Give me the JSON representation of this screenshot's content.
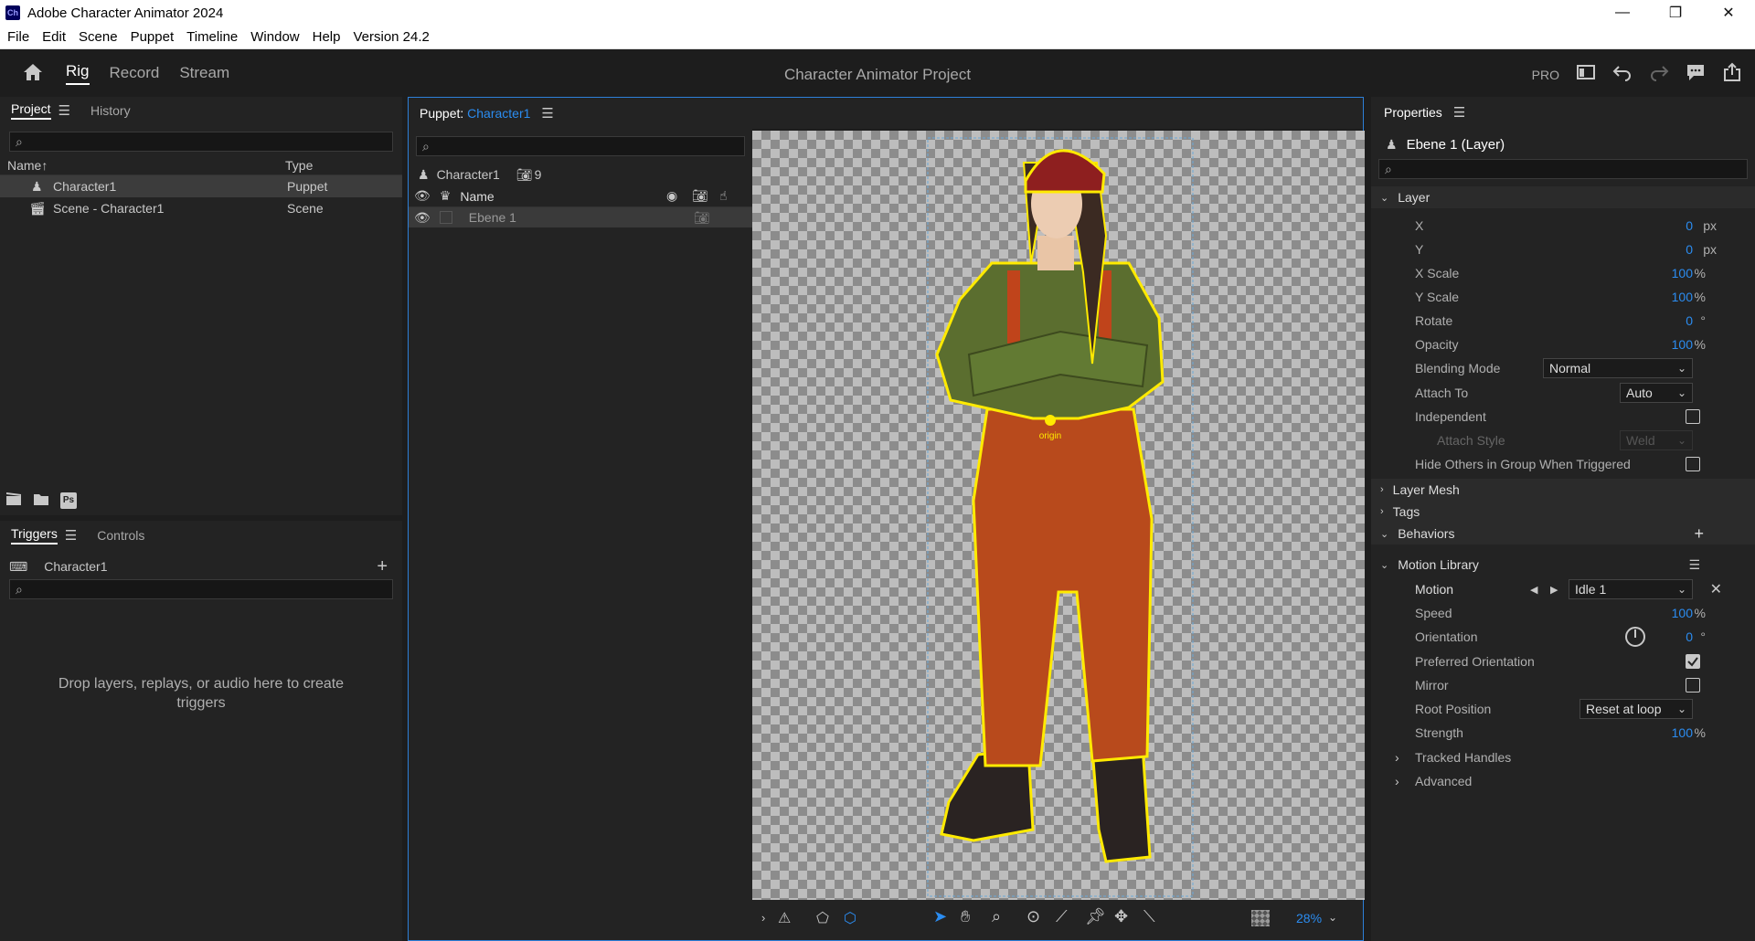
{
  "window": {
    "app_icon": "Ch",
    "title": "Adobe Character Animator 2024",
    "controls": [
      "—",
      "❐",
      "✕"
    ]
  },
  "menu": [
    "File",
    "Edit",
    "Scene",
    "Puppet",
    "Timeline",
    "Window",
    "Help",
    "Version 24.2"
  ],
  "workspace": {
    "tabs": [
      "Rig",
      "Record",
      "Stream"
    ],
    "active": "Rig",
    "project_title": "Character Animator Project",
    "pro_label": "PRO"
  },
  "project_panel": {
    "tabs": [
      "Project",
      "History"
    ],
    "columns": [
      "Name",
      "Type"
    ],
    "sort_indicator": "↑",
    "items": [
      {
        "name": "Character1",
        "type": "Puppet"
      },
      {
        "name": "Scene - Character1",
        "type": "Scene"
      }
    ],
    "footer_ps": "Ps"
  },
  "triggers_panel": {
    "tabs": [
      "Triggers",
      "Controls"
    ],
    "puppet": "Character1",
    "empty_message": "Drop layers, replays, or audio here to create triggers"
  },
  "puppet_panel": {
    "prefix": "Puppet: ",
    "puppet_name": "Character1",
    "header_name": "Character1",
    "count": "9",
    "name_column": "Name",
    "layers": [
      {
        "name": "Ebene 1"
      }
    ]
  },
  "canvas": {
    "origin_label": "origin",
    "zoom": "28%"
  },
  "properties": {
    "title": "Properties",
    "layer_name": "Ebene 1 (Layer)",
    "sections": {
      "layer": "Layer",
      "layer_mesh": "Layer Mesh",
      "tags": "Tags",
      "behaviors": "Behaviors",
      "motion_library": "Motion Library"
    },
    "layer_props": {
      "x": {
        "label": "X",
        "value": "0",
        "unit": "px"
      },
      "y": {
        "label": "Y",
        "value": "0",
        "unit": "px"
      },
      "xscale": {
        "label": "X Scale",
        "value": "100",
        "unit": "%"
      },
      "yscale": {
        "label": "Y Scale",
        "value": "100",
        "unit": "%"
      },
      "rotate": {
        "label": "Rotate",
        "value": "0",
        "unit": "°"
      },
      "opacity": {
        "label": "Opacity",
        "value": "100",
        "unit": "%"
      },
      "blending_mode": {
        "label": "Blending Mode",
        "value": "Normal"
      },
      "attach_to": {
        "label": "Attach To",
        "value": "Auto"
      },
      "independent": {
        "label": "Independent",
        "checked": false
      },
      "attach_style": {
        "label": "Attach Style",
        "value": "Weld"
      },
      "hide_others": {
        "label": "Hide Others in Group When Triggered",
        "checked": false
      }
    },
    "motion_props": {
      "motion": {
        "label": "Motion",
        "value": "Idle 1"
      },
      "speed": {
        "label": "Speed",
        "value": "100",
        "unit": "%"
      },
      "orientation": {
        "label": "Orientation",
        "value": "0",
        "unit": "°"
      },
      "preferred_orientation": {
        "label": "Preferred Orientation",
        "checked": true
      },
      "mirror": {
        "label": "Mirror",
        "checked": false
      },
      "root_position": {
        "label": "Root Position",
        "value": "Reset at loop"
      },
      "strength": {
        "label": "Strength",
        "value": "100",
        "unit": "%"
      },
      "tracked_handles": {
        "label": "Tracked Handles"
      },
      "advanced": {
        "label": "Advanced"
      }
    }
  },
  "colors": {
    "accent": "#2b8cf0",
    "panel_bg": "#232323",
    "app_bg": "#1d1d1d",
    "selection": "#3c3c3c"
  }
}
